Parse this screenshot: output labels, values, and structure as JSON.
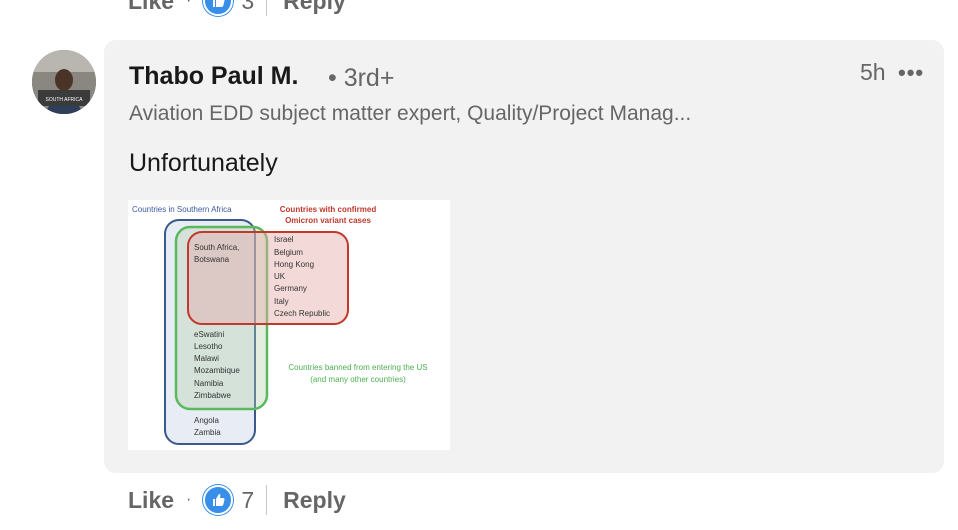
{
  "previous_comment": {
    "like_label": "Like",
    "reaction_count": "3",
    "reply_label": "Reply"
  },
  "comment": {
    "author_name": "Thabo Paul M.",
    "connection_degree": "• 3rd+",
    "timestamp": "5h",
    "more_label": "•••",
    "headline": "Aviation EDD subject matter expert, Quality/Project Manag...",
    "text": "Unfortunately",
    "avatar_text": "SOUTH AFRICA",
    "image": {
      "title_left": "Countries in Southern Africa",
      "title_right_line1": "Countries with confirmed",
      "title_right_line2": "Omicron variant cases",
      "intersection": [
        "South Africa,",
        "Botswana"
      ],
      "omicron_only": [
        "Israel",
        "Belgium",
        "Hong Kong",
        "UK",
        "Germany",
        "Italy",
        "Czech Republic"
      ],
      "banned_southern": [
        "eSwatini",
        "Lesotho",
        "Malawi",
        "Mozambique",
        "Namibia",
        "Zimbabwe"
      ],
      "southern_only": [
        "Angola",
        "Zambia"
      ],
      "banned_label_line1": "Countries banned from entering the US",
      "banned_label_line2": "(and many other countries)"
    },
    "actions": {
      "like_label": "Like",
      "dot": "·",
      "reaction_count": "7",
      "reply_label": "Reply"
    }
  },
  "colors": {
    "blue_circle": "#3a5a8c",
    "green_circle": "#4caf50",
    "red_circle": "#c0392b",
    "like_blue": "#378fe9",
    "bubble_bg": "#f2f2f2"
  }
}
